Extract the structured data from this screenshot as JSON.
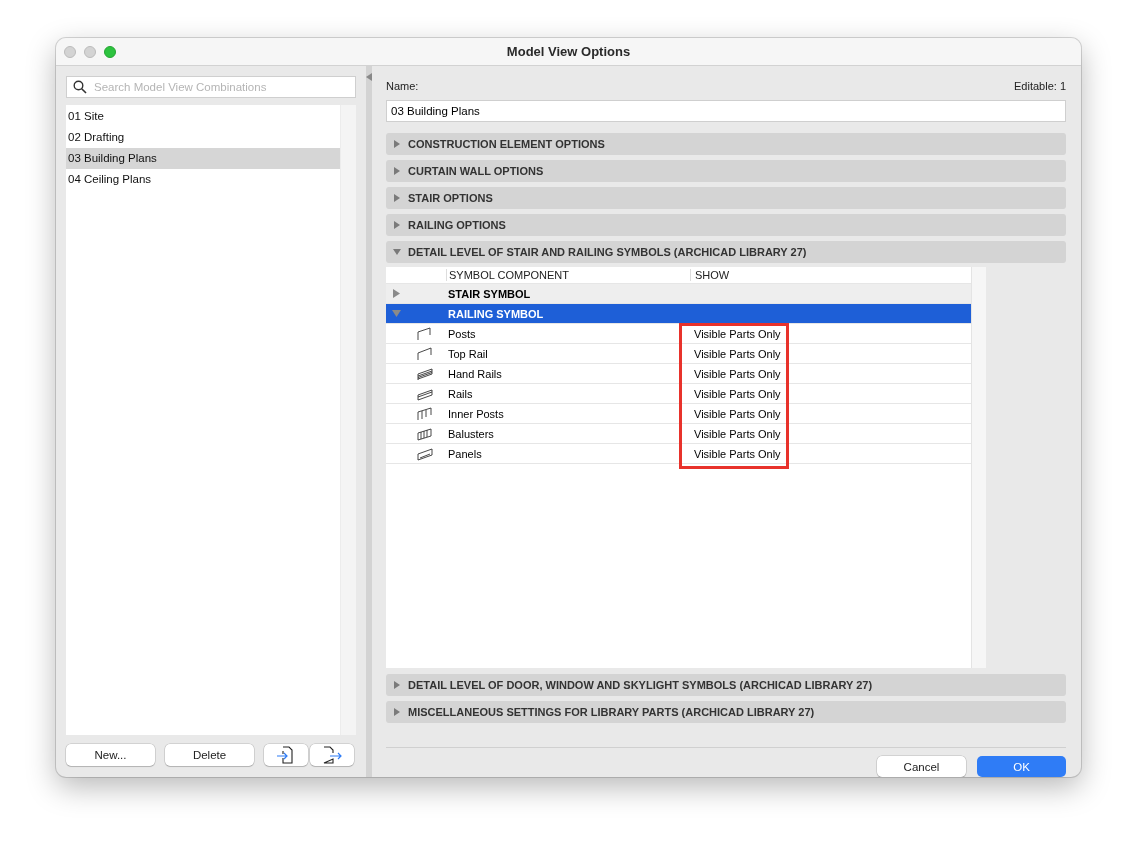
{
  "window": {
    "title": "Model View Options"
  },
  "sidebar": {
    "search": {
      "placeholder": "Search Model View Combinations"
    },
    "items": [
      {
        "label": "01 Site",
        "selected": false
      },
      {
        "label": "02 Drafting",
        "selected": false
      },
      {
        "label": "03 Building Plans",
        "selected": true
      },
      {
        "label": "04 Ceiling Plans",
        "selected": false
      }
    ],
    "buttons": [
      {
        "kind": "text",
        "label": "New..."
      },
      {
        "kind": "text",
        "label": "Delete"
      },
      {
        "kind": "import"
      },
      {
        "kind": "export"
      }
    ]
  },
  "name_label": "Name:",
  "editable": "Editable: 1",
  "name_value": "03 Building Plans",
  "sections": [
    {
      "title": "CONSTRUCTION ELEMENT OPTIONS",
      "expanded": false
    },
    {
      "title": "CURTAIN WALL OPTIONS",
      "expanded": false
    },
    {
      "title": "STAIR OPTIONS",
      "expanded": false
    },
    {
      "title": "RAILING OPTIONS",
      "expanded": false
    },
    {
      "title": "DETAIL LEVEL OF STAIR AND RAILING SYMBOLS (ARCHICAD LIBRARY 27)",
      "expanded": true,
      "table": {
        "columns": [
          "SYMBOL COMPONENT",
          "SHOW"
        ],
        "highlight_show_column": true,
        "groups": [
          {
            "label": "STAIR SYMBOL",
            "expanded": false,
            "selected": false
          },
          {
            "label": "RAILING SYMBOL",
            "expanded": true,
            "selected": true,
            "rows": [
              {
                "kind": "post",
                "name": "Posts",
                "show": "Visible Parts Only"
              },
              {
                "kind": "top-rail",
                "name": "Top Rail",
                "show": "Visible Parts Only"
              },
              {
                "kind": "hand-rail",
                "name": "Hand Rails",
                "show": "Visible Parts Only"
              },
              {
                "kind": "rail",
                "name": "Rails",
                "show": "Visible Parts Only"
              },
              {
                "kind": "inner-post",
                "name": "Inner Posts",
                "show": "Visible Parts Only"
              },
              {
                "kind": "baluster",
                "name": "Balusters",
                "show": "Visible Parts Only"
              },
              {
                "kind": "panel",
                "name": "Panels",
                "show": "Visible Parts Only"
              }
            ]
          }
        ]
      }
    },
    {
      "title": "DETAIL LEVEL OF DOOR, WINDOW AND SKYLIGHT SYMBOLS (ARCHICAD LIBRARY 27)",
      "expanded": false
    },
    {
      "title": "MISCELLANEOUS SETTINGS FOR LIBRARY PARTS (ARCHICAD LIBRARY 27)",
      "expanded": false
    }
  ],
  "footer_buttons": [
    {
      "label": "Cancel",
      "primary": false
    },
    {
      "label": "OK",
      "primary": true
    }
  ]
}
